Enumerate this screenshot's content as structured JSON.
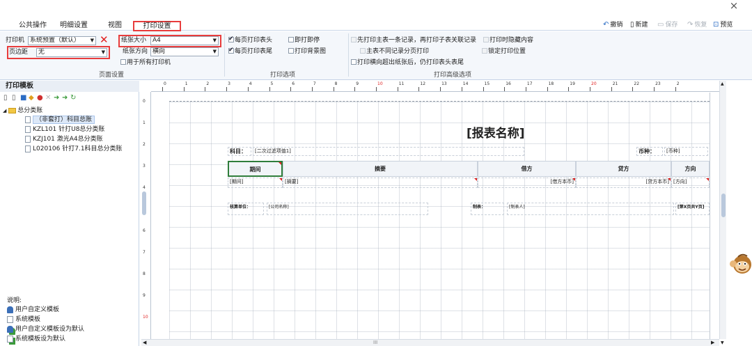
{
  "window": {
    "close": "×"
  },
  "menu": {
    "items": [
      "公共操作",
      "明细设置",
      "视图"
    ],
    "active": "打印设置"
  },
  "toolbar": {
    "undo": "撤销",
    "new": "新建",
    "save": "保存",
    "restore": "恢复",
    "preview": "预览"
  },
  "page_settings": {
    "printer_label": "打印机",
    "printer_value": "系统预置（默认）",
    "margin_label": "页边距",
    "margin_value": "无",
    "paper_size_label": "纸张大小",
    "paper_size_value": "A4",
    "paper_orient_label": "纸张方向",
    "paper_orient_value": "横向",
    "all_printers": "用于所有打印机",
    "title": "页面设置"
  },
  "print_options": {
    "header_each_page": "每页打印表头",
    "print_now": "即打即停",
    "footer_each_page": "每页打印表尾",
    "print_background": "打印背景图",
    "title": "打印选项"
  },
  "advanced_options": {
    "master_first": "先打印主表一条记录，再打印子表关联记录",
    "hide_content": "打印时隐藏内容",
    "no_split": "主表不同记录分页打印",
    "lock_position": "锁定打印位置",
    "overflow_header": "打印横向超出纸张后，仍打印表头表尾",
    "title": "打印高级选项"
  },
  "left_panel": {
    "title": "打印模板",
    "root": "总分类账",
    "items": [
      "（非套打）科目总账",
      "KZL101 针打U8总分类账",
      "KZJ101 激光A4总分类账",
      "L020106 针打7.1科目总分类账"
    ],
    "legend_title": "说明:",
    "legend": [
      "用户自定义模板",
      "系统模板",
      "用户自定义模板设为默认",
      "系统模板设为默认"
    ]
  },
  "ruler": {
    "top": [
      "0",
      "1",
      "2",
      "3",
      "4",
      "5",
      "6",
      "7",
      "8",
      "9",
      "10",
      "11",
      "12",
      "13",
      "14",
      "15",
      "16",
      "17",
      "18",
      "19",
      "20",
      "21",
      "22",
      "23",
      "2"
    ],
    "left": [
      "0",
      "1",
      "2",
      "3",
      "4",
      "5",
      "6",
      "7",
      "8",
      "9",
      "10"
    ]
  },
  "report": {
    "title": "[报表名称]",
    "subject_label": "科目：",
    "subject_value": "[二次过滤项值1]",
    "currency_label": "币种：",
    "currency_value": "[币种]",
    "headers": [
      "期间",
      "摘要",
      "借方",
      "贷方",
      "方向"
    ],
    "row": [
      "[期间]",
      "[摘要]",
      "[借方本币]",
      "[贷方本币]",
      "[方向]"
    ],
    "footer_unit_label": "核算单位：",
    "footer_unit_value": "[公司名称]",
    "footer_maker_label": "制表：",
    "footer_maker_value": "[制表人]",
    "footer_page": "[第X页共Y页]"
  },
  "scroll": {
    "hmark": "III"
  },
  "colors": {
    "highlight": "#e83c3c",
    "ribbon_bg": "#f4f7fb",
    "accent": "#2b6cc4"
  }
}
